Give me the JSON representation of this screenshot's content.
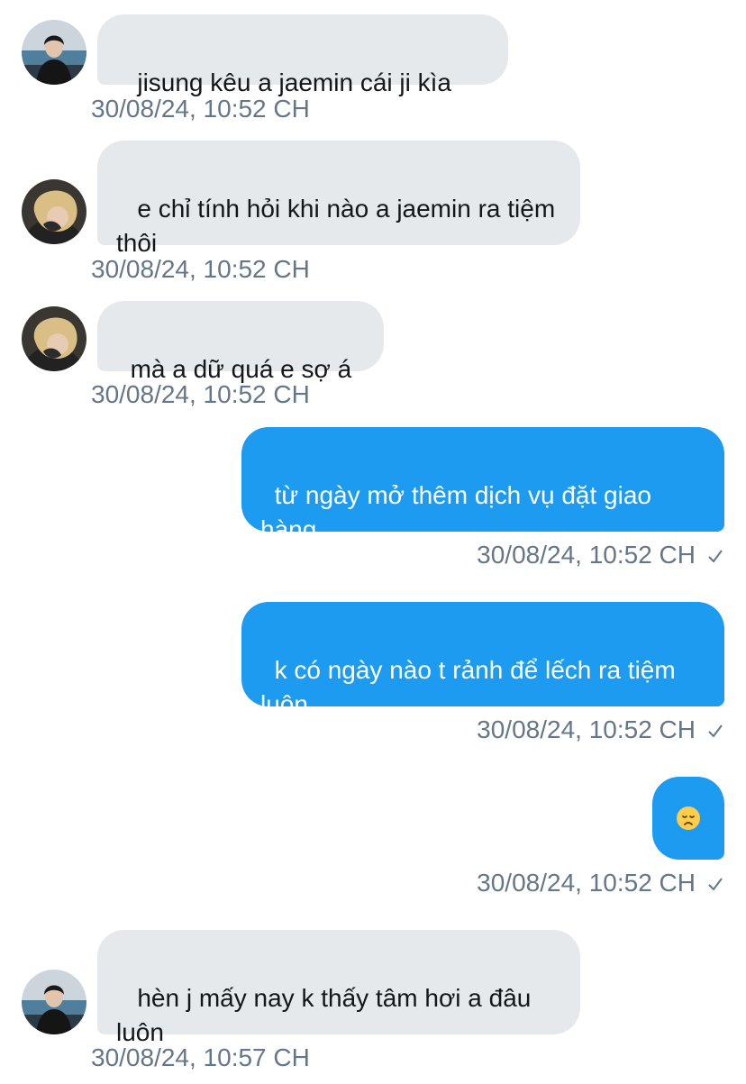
{
  "messages": [
    {
      "side": "in",
      "avatar": "avatar-boy",
      "text": " jisung kêu a jaemin cái ji kìa",
      "time": "30/08/24, 10:52 CH"
    },
    {
      "side": "in",
      "avatar": "avatar-blonde",
      "text": " e chỉ tính hỏi khi nào a jaemin ra tiệm thôi",
      "time": "30/08/24, 10:52 CH"
    },
    {
      "side": "in",
      "avatar": "avatar-blonde",
      "text": "mà a dữ quá e sợ á",
      "time": "30/08/24, 10:52 CH"
    },
    {
      "side": "out",
      "text": "từ ngày mở thêm dịch vụ đặt giao hàng",
      "time": "30/08/24, 10:52 CH",
      "status": "sent-check-icon"
    },
    {
      "side": "out",
      "text": "k có ngày nào t rảnh để lếch ra tiệm luôn",
      "time": "30/08/24, 10:52 CH",
      "status": "sent-check-icon"
    },
    {
      "side": "out",
      "text": "😞",
      "time": "30/08/24, 10:52 CH",
      "status": "sent-check-icon"
    },
    {
      "side": "in",
      "avatar": "avatar-boy",
      "text": " hèn j mấy nay k thấy tâm hơi a đâu luôn",
      "time": "30/08/24, 10:57 CH"
    }
  ],
  "colors": {
    "incoming_bubble": "#e6e9ec",
    "outgoing_bubble": "#1d9bf0",
    "timestamp": "#657786"
  }
}
